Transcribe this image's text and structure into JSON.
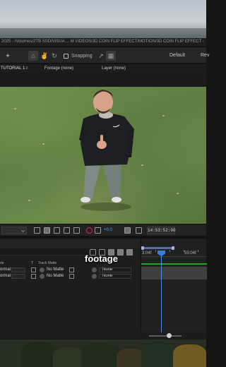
{
  "window": {
    "title": "2025 - /Volumes/2TB SSD/VISUA ... M VIDEOS/3D COIN FLIP EFFECT/MOTION/3D COIN FLIP EFFECT -"
  },
  "toolbar": {
    "snapping_label": "Snapping",
    "workspace_default": "Default",
    "workspace_review": "Rev"
  },
  "panel_tabs": {
    "composition": "TUTORIAL 1",
    "footage": "Footage (none)",
    "layer": "Layer (none)"
  },
  "viewer": {
    "exposure": "+0.0",
    "timecode": "14:53:52:00"
  },
  "overlay_caption": "footage",
  "timeline": {
    "columns": {
      "mode": "de",
      "t": "T",
      "track_matte": "Track Matte"
    },
    "ruler": {
      "start": "3:04f",
      "end": "55:04f"
    },
    "rows": [
      {
        "mode": "ormal",
        "track_matte": "No Matte",
        "parent": "None"
      },
      {
        "mode": "ormal",
        "track_matte": "No Matte",
        "parent": "None"
      }
    ]
  },
  "colors": {
    "accent_blue": "#4f8be8",
    "green_bar": "#1fa41f"
  },
  "icons": [
    "pin-icon",
    "home-icon",
    "hand-tool-icon",
    "rotate-icon",
    "snapping-checkbox-icon",
    "expand-icon",
    "grid-icon",
    "camera-icon",
    "color-wheel-icon"
  ]
}
